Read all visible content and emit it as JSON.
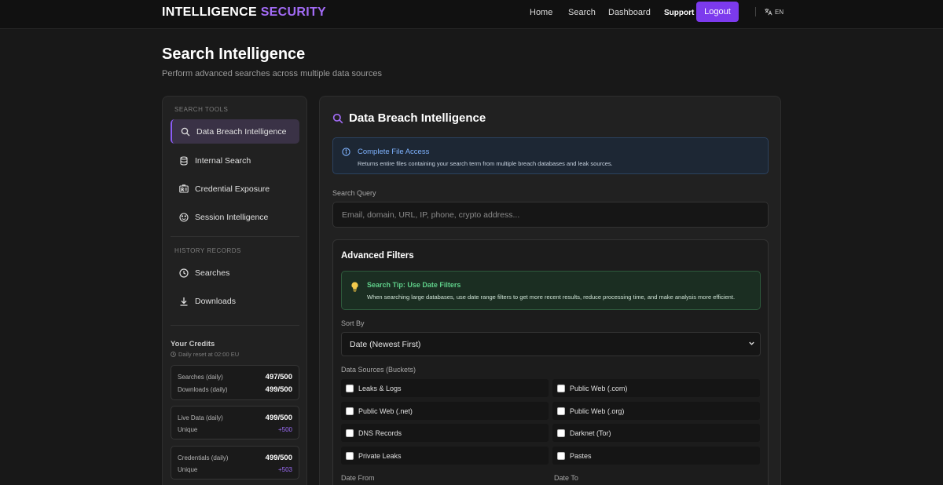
{
  "navbar": {
    "brand_main": "INTELLIGENCE",
    "brand_accent": "SECURITY",
    "links": [
      "Home",
      "Search",
      "Dashboard"
    ],
    "support": "Support",
    "logout": "Logout",
    "language": "EN"
  },
  "page": {
    "title": "Search Intelligence",
    "subtitle": "Perform advanced searches across multiple data sources"
  },
  "sidebar": {
    "tools_heading": "SEARCH TOOLS",
    "tools": [
      {
        "label": "Data Breach Intelligence",
        "icon": "search-icon",
        "active": true
      },
      {
        "label": "Internal Search",
        "icon": "database-icon",
        "active": false
      },
      {
        "label": "Credential Exposure",
        "icon": "id-card-icon",
        "active": false
      },
      {
        "label": "Session Intelligence",
        "icon": "cookie-icon",
        "active": false
      }
    ],
    "history_heading": "HISTORY RECORDS",
    "history": [
      {
        "label": "Searches",
        "icon": "clock-icon"
      },
      {
        "label": "Downloads",
        "icon": "download-icon"
      }
    ],
    "credits": {
      "title": "Your Credits",
      "reset": "Daily reset at 02:00 EU",
      "cards": [
        {
          "rows": [
            {
              "label": "Searches (daily)",
              "value": "497/500"
            },
            {
              "label": "Downloads (daily)",
              "value": "499/500"
            }
          ]
        },
        {
          "rows": [
            {
              "label": "Live Data (daily)",
              "value": "499/500"
            },
            {
              "label": "Unique",
              "value": "+500"
            }
          ]
        },
        {
          "rows": [
            {
              "label": "Credentials (daily)",
              "value": "499/500"
            },
            {
              "label": "Unique",
              "value": "+503"
            }
          ]
        }
      ]
    }
  },
  "main": {
    "title": "Data Breach Intelligence",
    "info": {
      "title": "Complete File Access",
      "text": "Returns entire files containing your search term from multiple breach databases and leak sources."
    },
    "query_label": "Search Query",
    "query_placeholder": "Email, domain, URL, IP, phone, crypto address...",
    "query_value": "",
    "filters": {
      "title": "Advanced Filters",
      "tip_title": "Search Tip: Use Date Filters",
      "tip_text": "When searching large databases, use date range filters to get more recent results, reduce processing time, and make analysis more efficient.",
      "sort_label": "Sort By",
      "sort_value": "Date (Newest First)",
      "sources_label": "Data Sources (Buckets)",
      "sources": [
        {
          "label": "Leaks & Logs",
          "checked": false
        },
        {
          "label": "Public Web (.com)",
          "checked": false
        },
        {
          "label": "Public Web (.net)",
          "checked": false
        },
        {
          "label": "Public Web (.org)",
          "checked": false
        },
        {
          "label": "DNS Records",
          "checked": false
        },
        {
          "label": "Darknet (Tor)",
          "checked": false
        },
        {
          "label": "Private Leaks",
          "checked": false
        },
        {
          "label": "Pastes",
          "checked": false
        }
      ],
      "date_from_label": "Date From",
      "date_to_label": "Date To"
    }
  },
  "colors": {
    "accent": "#7c3aed",
    "info_blue": "#7fb3ff",
    "tip_green": "#5fd08a"
  }
}
